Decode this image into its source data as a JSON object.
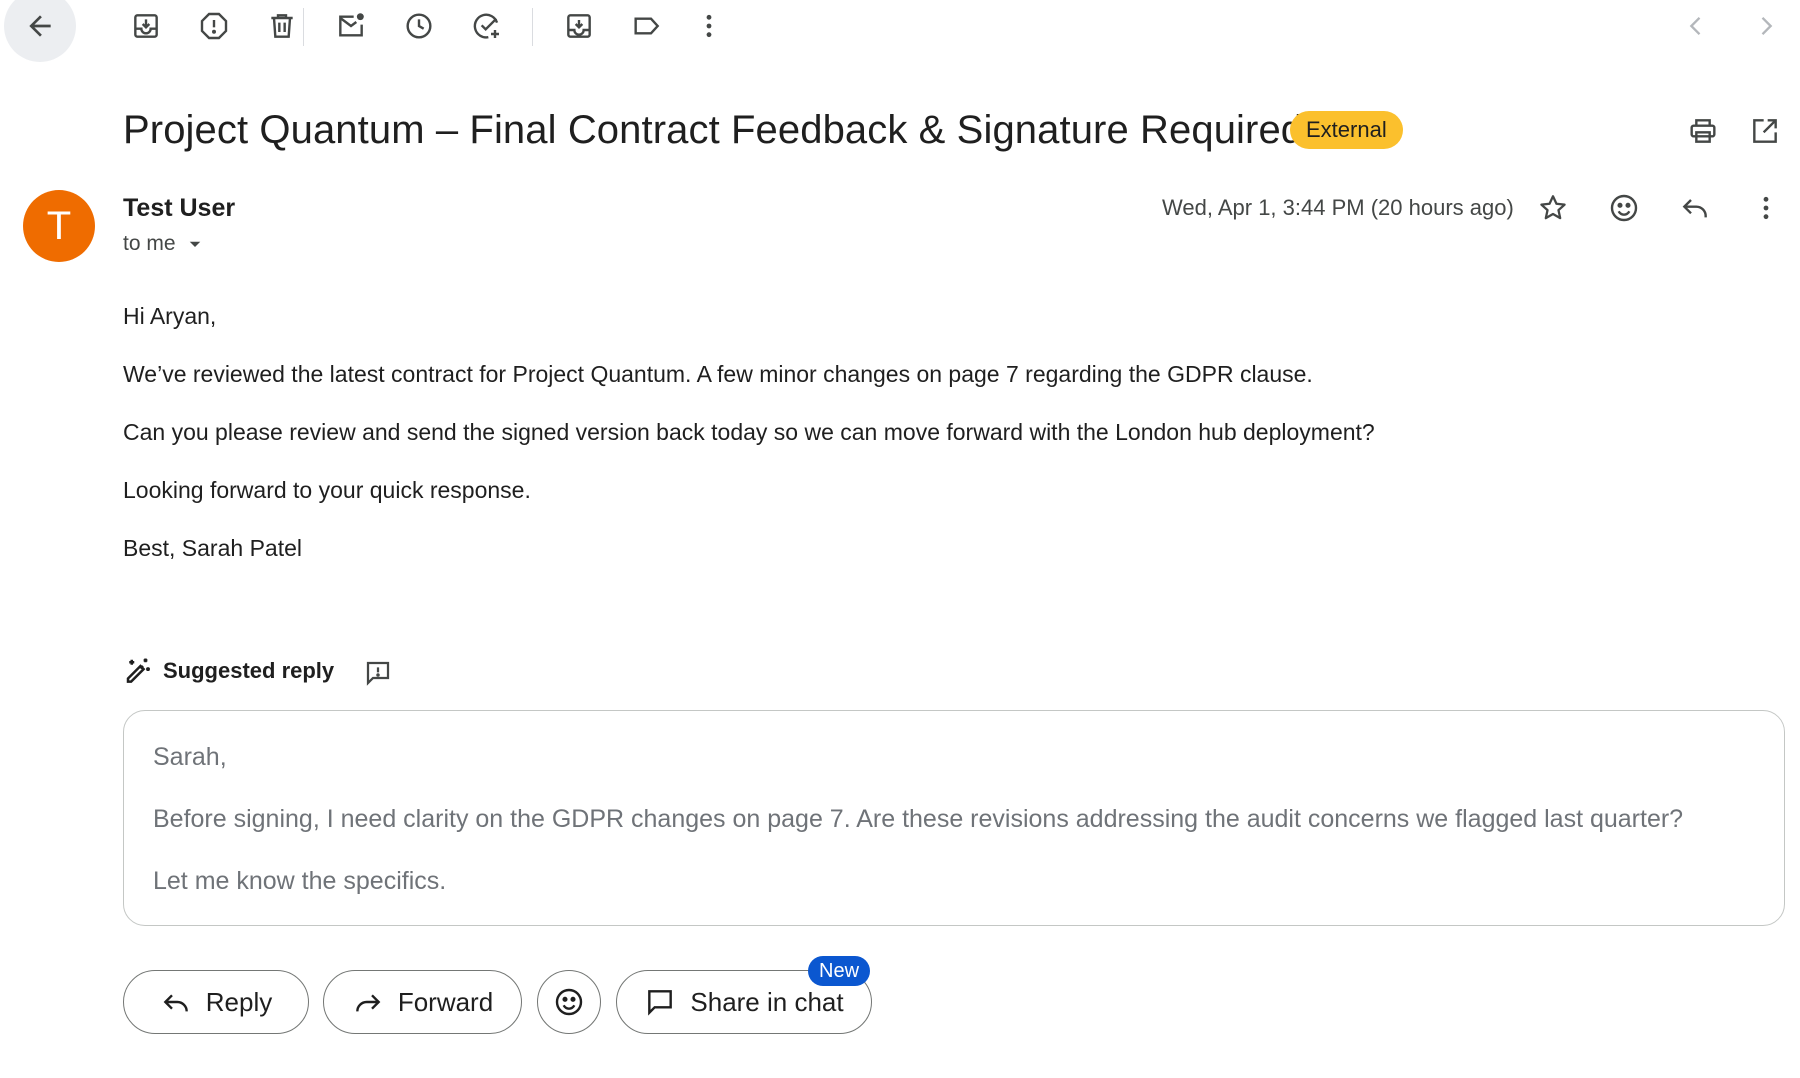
{
  "toolbar": {
    "back": "back-arrow-icon",
    "actions": [
      "archive-icon",
      "report-spam-icon",
      "delete-icon",
      "mark-unread-icon",
      "snooze-icon",
      "add-task-icon",
      "move-to-icon",
      "label-icon",
      "more-vert-icon"
    ],
    "nav": [
      "chevron-left-icon",
      "chevron-right-icon"
    ]
  },
  "subject": {
    "text": "Project Quantum – Final Contract Feedback & Signature Required",
    "badge": "External",
    "badge_color": "#fbc02d"
  },
  "sender": {
    "avatar_letter": "T",
    "avatar_color": "#ef6c00",
    "name": "Test User",
    "recipient": "to me",
    "date": "Wed, Apr 1, 3:44 PM (20 hours ago)"
  },
  "body": [
    "Hi Aryan,",
    "We’ve reviewed the latest contract for Project Quantum. A few minor changes on page 7 regarding the GDPR clause.",
    "Can you please review and send the signed version back today so we can move forward with the London hub deployment?",
    "Looking forward to your quick response.",
    "Best, Sarah Patel"
  ],
  "suggested_reply": {
    "heading": "Suggested reply",
    "lines": [
      "Sarah,",
      "Before signing, I need clarity on the GDPR changes on page 7. Are these revisions addressing the audit concerns we flagged last quarter?",
      "Let me know the specifics."
    ]
  },
  "actions": {
    "reply": "Reply",
    "forward": "Forward",
    "share_in_chat": "Share in chat",
    "new_badge": "New",
    "new_badge_color": "#0b57d0"
  }
}
